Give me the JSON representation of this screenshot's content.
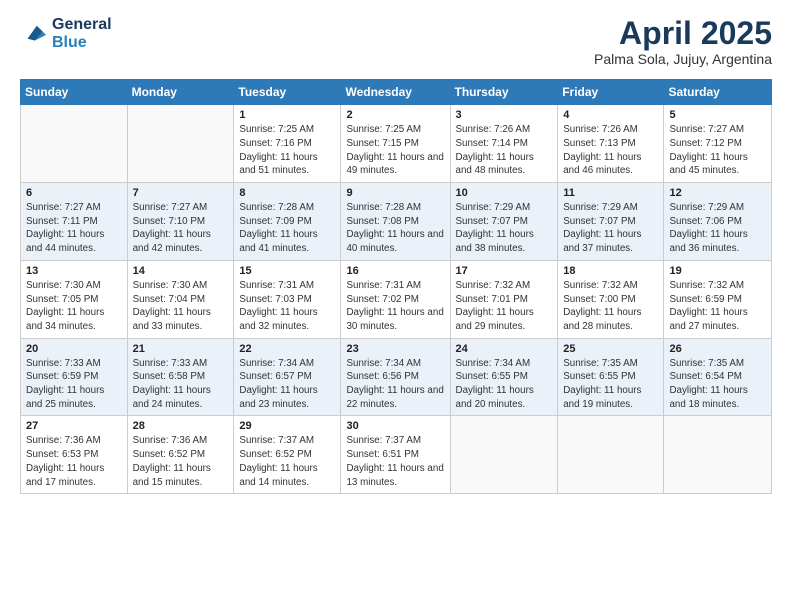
{
  "header": {
    "logo_line1": "General",
    "logo_line2": "Blue",
    "month": "April 2025",
    "location": "Palma Sola, Jujuy, Argentina"
  },
  "weekdays": [
    "Sunday",
    "Monday",
    "Tuesday",
    "Wednesday",
    "Thursday",
    "Friday",
    "Saturday"
  ],
  "weeks": [
    [
      {
        "day": "",
        "sunrise": "",
        "sunset": "",
        "daylight": ""
      },
      {
        "day": "",
        "sunrise": "",
        "sunset": "",
        "daylight": ""
      },
      {
        "day": "1",
        "sunrise": "Sunrise: 7:25 AM",
        "sunset": "Sunset: 7:16 PM",
        "daylight": "Daylight: 11 hours and 51 minutes."
      },
      {
        "day": "2",
        "sunrise": "Sunrise: 7:25 AM",
        "sunset": "Sunset: 7:15 PM",
        "daylight": "Daylight: 11 hours and 49 minutes."
      },
      {
        "day": "3",
        "sunrise": "Sunrise: 7:26 AM",
        "sunset": "Sunset: 7:14 PM",
        "daylight": "Daylight: 11 hours and 48 minutes."
      },
      {
        "day": "4",
        "sunrise": "Sunrise: 7:26 AM",
        "sunset": "Sunset: 7:13 PM",
        "daylight": "Daylight: 11 hours and 46 minutes."
      },
      {
        "day": "5",
        "sunrise": "Sunrise: 7:27 AM",
        "sunset": "Sunset: 7:12 PM",
        "daylight": "Daylight: 11 hours and 45 minutes."
      }
    ],
    [
      {
        "day": "6",
        "sunrise": "Sunrise: 7:27 AM",
        "sunset": "Sunset: 7:11 PM",
        "daylight": "Daylight: 11 hours and 44 minutes."
      },
      {
        "day": "7",
        "sunrise": "Sunrise: 7:27 AM",
        "sunset": "Sunset: 7:10 PM",
        "daylight": "Daylight: 11 hours and 42 minutes."
      },
      {
        "day": "8",
        "sunrise": "Sunrise: 7:28 AM",
        "sunset": "Sunset: 7:09 PM",
        "daylight": "Daylight: 11 hours and 41 minutes."
      },
      {
        "day": "9",
        "sunrise": "Sunrise: 7:28 AM",
        "sunset": "Sunset: 7:08 PM",
        "daylight": "Daylight: 11 hours and 40 minutes."
      },
      {
        "day": "10",
        "sunrise": "Sunrise: 7:29 AM",
        "sunset": "Sunset: 7:07 PM",
        "daylight": "Daylight: 11 hours and 38 minutes."
      },
      {
        "day": "11",
        "sunrise": "Sunrise: 7:29 AM",
        "sunset": "Sunset: 7:07 PM",
        "daylight": "Daylight: 11 hours and 37 minutes."
      },
      {
        "day": "12",
        "sunrise": "Sunrise: 7:29 AM",
        "sunset": "Sunset: 7:06 PM",
        "daylight": "Daylight: 11 hours and 36 minutes."
      }
    ],
    [
      {
        "day": "13",
        "sunrise": "Sunrise: 7:30 AM",
        "sunset": "Sunset: 7:05 PM",
        "daylight": "Daylight: 11 hours and 34 minutes."
      },
      {
        "day": "14",
        "sunrise": "Sunrise: 7:30 AM",
        "sunset": "Sunset: 7:04 PM",
        "daylight": "Daylight: 11 hours and 33 minutes."
      },
      {
        "day": "15",
        "sunrise": "Sunrise: 7:31 AM",
        "sunset": "Sunset: 7:03 PM",
        "daylight": "Daylight: 11 hours and 32 minutes."
      },
      {
        "day": "16",
        "sunrise": "Sunrise: 7:31 AM",
        "sunset": "Sunset: 7:02 PM",
        "daylight": "Daylight: 11 hours and 30 minutes."
      },
      {
        "day": "17",
        "sunrise": "Sunrise: 7:32 AM",
        "sunset": "Sunset: 7:01 PM",
        "daylight": "Daylight: 11 hours and 29 minutes."
      },
      {
        "day": "18",
        "sunrise": "Sunrise: 7:32 AM",
        "sunset": "Sunset: 7:00 PM",
        "daylight": "Daylight: 11 hours and 28 minutes."
      },
      {
        "day": "19",
        "sunrise": "Sunrise: 7:32 AM",
        "sunset": "Sunset: 6:59 PM",
        "daylight": "Daylight: 11 hours and 27 minutes."
      }
    ],
    [
      {
        "day": "20",
        "sunrise": "Sunrise: 7:33 AM",
        "sunset": "Sunset: 6:59 PM",
        "daylight": "Daylight: 11 hours and 25 minutes."
      },
      {
        "day": "21",
        "sunrise": "Sunrise: 7:33 AM",
        "sunset": "Sunset: 6:58 PM",
        "daylight": "Daylight: 11 hours and 24 minutes."
      },
      {
        "day": "22",
        "sunrise": "Sunrise: 7:34 AM",
        "sunset": "Sunset: 6:57 PM",
        "daylight": "Daylight: 11 hours and 23 minutes."
      },
      {
        "day": "23",
        "sunrise": "Sunrise: 7:34 AM",
        "sunset": "Sunset: 6:56 PM",
        "daylight": "Daylight: 11 hours and 22 minutes."
      },
      {
        "day": "24",
        "sunrise": "Sunrise: 7:34 AM",
        "sunset": "Sunset: 6:55 PM",
        "daylight": "Daylight: 11 hours and 20 minutes."
      },
      {
        "day": "25",
        "sunrise": "Sunrise: 7:35 AM",
        "sunset": "Sunset: 6:55 PM",
        "daylight": "Daylight: 11 hours and 19 minutes."
      },
      {
        "day": "26",
        "sunrise": "Sunrise: 7:35 AM",
        "sunset": "Sunset: 6:54 PM",
        "daylight": "Daylight: 11 hours and 18 minutes."
      }
    ],
    [
      {
        "day": "27",
        "sunrise": "Sunrise: 7:36 AM",
        "sunset": "Sunset: 6:53 PM",
        "daylight": "Daylight: 11 hours and 17 minutes."
      },
      {
        "day": "28",
        "sunrise": "Sunrise: 7:36 AM",
        "sunset": "Sunset: 6:52 PM",
        "daylight": "Daylight: 11 hours and 15 minutes."
      },
      {
        "day": "29",
        "sunrise": "Sunrise: 7:37 AM",
        "sunset": "Sunset: 6:52 PM",
        "daylight": "Daylight: 11 hours and 14 minutes."
      },
      {
        "day": "30",
        "sunrise": "Sunrise: 7:37 AM",
        "sunset": "Sunset: 6:51 PM",
        "daylight": "Daylight: 11 hours and 13 minutes."
      },
      {
        "day": "",
        "sunrise": "",
        "sunset": "",
        "daylight": ""
      },
      {
        "day": "",
        "sunrise": "",
        "sunset": "",
        "daylight": ""
      },
      {
        "day": "",
        "sunrise": "",
        "sunset": "",
        "daylight": ""
      }
    ]
  ]
}
